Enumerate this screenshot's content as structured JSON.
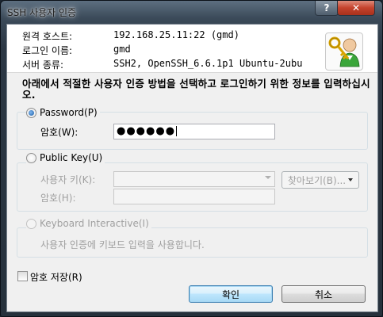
{
  "window": {
    "title": "SSH 사용자 인증",
    "help": "?",
    "close": "✕"
  },
  "connection": {
    "rows": [
      {
        "label": "원격 호스트:",
        "value": "192.168.25.11:22 (gmd)"
      },
      {
        "label": "로그인 이름:",
        "value": "gmd"
      },
      {
        "label": "서버 종류:",
        "value": "SSH2, OpenSSH_6.6.1p1 Ubuntu-2ubu"
      }
    ]
  },
  "instruction": "아래에서 적절한 사용자 인증 방법을 선택하고 로그인하기 위한 정보를 입력하십시오.",
  "password_option": {
    "label": "Password(P)",
    "field_label": "암호(W):",
    "masked_value": "●●●●●●",
    "selected": true
  },
  "publickey_option": {
    "label": "Public Key(U)",
    "key_label": "사용자 키(K):",
    "browse_label": "찾아보기(B)...",
    "passphrase_label": "암호(H):"
  },
  "keyboard_option": {
    "label": "Keyboard Interactive(I)",
    "description": "사용자 인증에 키보드 입력을 사용합니다."
  },
  "save_password": {
    "label": "암호 저장(R)",
    "checked": false
  },
  "buttons": {
    "ok": "확인",
    "cancel": "취소"
  },
  "icons": {
    "app_icon": "user-key-icon",
    "browse_menu": "triangle-down-icon"
  },
  "colors": {
    "accent": "#3c7fb1",
    "frame": "#2b3744"
  }
}
